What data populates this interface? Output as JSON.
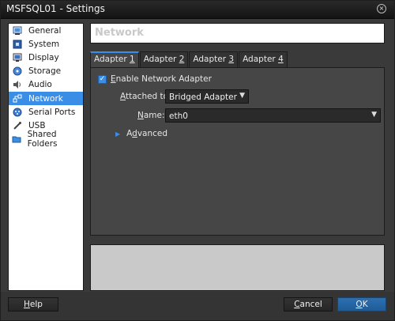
{
  "window": {
    "title": "MSFSQL01 - Settings"
  },
  "sidebar": {
    "items": [
      {
        "label": "General",
        "icon": "monitor-icon"
      },
      {
        "label": "System",
        "icon": "chip-icon"
      },
      {
        "label": "Display",
        "icon": "display-icon"
      },
      {
        "label": "Storage",
        "icon": "disk-icon"
      },
      {
        "label": "Audio",
        "icon": "speaker-icon"
      },
      {
        "label": "Network",
        "icon": "network-icon",
        "selected": true
      },
      {
        "label": "Serial Ports",
        "icon": "serial-icon"
      },
      {
        "label": "USB",
        "icon": "usb-icon"
      },
      {
        "label": "Shared Folders",
        "icon": "folder-icon"
      }
    ]
  },
  "page": {
    "title": "Network"
  },
  "tabs": [
    {
      "label": "Adapter ",
      "num": "1",
      "active": true
    },
    {
      "label": "Adapter ",
      "num": "2"
    },
    {
      "label": "Adapter ",
      "num": "3"
    },
    {
      "label": "Adapter ",
      "num": "4"
    }
  ],
  "adapter": {
    "enable_label_pre": "",
    "enable_label_acc": "E",
    "enable_label_post": "nable Network Adapter",
    "enabled": true,
    "attached_label_acc": "A",
    "attached_label_post": "ttached to:",
    "attached_value": "Bridged Adapter",
    "name_label_acc": "N",
    "name_label_post": "ame:",
    "name_value": "eth0",
    "advanced_label_pre": "A",
    "advanced_label_acc": "d",
    "advanced_label_post": "vanced"
  },
  "footer": {
    "help_acc": "H",
    "help_post": "elp",
    "cancel_acc": "C",
    "cancel_post": "ancel",
    "ok_acc": "O",
    "ok_post": "K"
  },
  "colors": {
    "accent": "#3a8ee6",
    "background": "#3a3a3a"
  }
}
